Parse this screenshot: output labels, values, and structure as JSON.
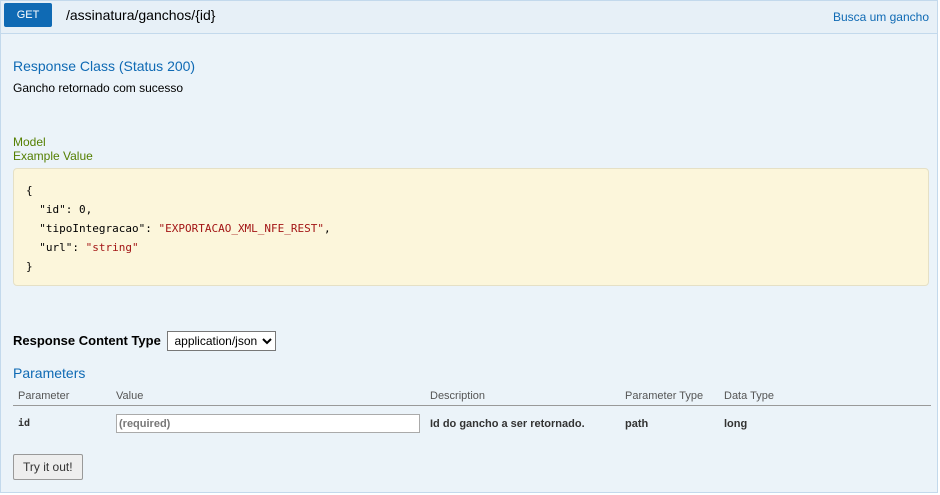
{
  "operation": {
    "method": "GET",
    "path": "/assinatura/ganchos/{id}",
    "summary": "Busca um gancho"
  },
  "response_class": {
    "heading": "Response Class (Status 200)",
    "description": "Gancho retornado com sucesso"
  },
  "model_tabs": {
    "model": "Model",
    "example": "Example Value"
  },
  "example_json": {
    "open": "{",
    "lines": [
      {
        "key": "\"id\"",
        "value": "0",
        "suffix": ","
      },
      {
        "key": "\"tipoIntegracao\"",
        "value": "\"EXPORTACAO_XML_NFE_REST\"",
        "suffix": ","
      },
      {
        "key": "\"url\"",
        "value": "\"string\"",
        "suffix": ""
      }
    ],
    "close": "}"
  },
  "response_content_type": {
    "label": "Response Content Type",
    "selected": "application/json"
  },
  "parameters": {
    "heading": "Parameters",
    "columns": [
      "Parameter",
      "Value",
      "Description",
      "Parameter Type",
      "Data Type"
    ],
    "rows": [
      {
        "name": "id",
        "placeholder": "(required)",
        "description": "Id do gancho a ser retornado.",
        "param_type": "path",
        "data_type": "long"
      }
    ]
  },
  "try_button": "Try it out!",
  "colors": {
    "method_get": "#0f6ab4",
    "link_blue": "#0f6ab4",
    "model_green": "#547f00",
    "snippet_bg": "#fcf6db",
    "panel_bg": "#ebf3f9"
  }
}
